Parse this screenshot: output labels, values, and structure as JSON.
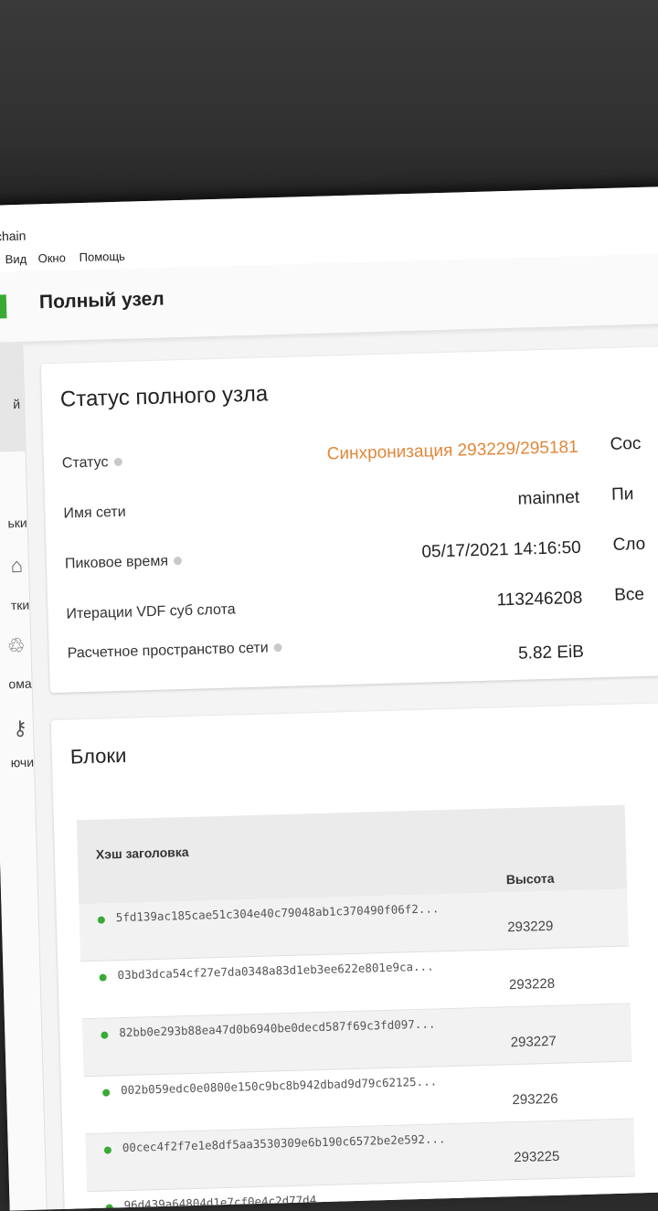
{
  "app": {
    "title": "chain"
  },
  "menu": {
    "items": [
      "а",
      "Вид",
      "Окно",
      "Помощь"
    ]
  },
  "header": {
    "title": "Полный узел"
  },
  "sidebar": {
    "items": [
      "й",
      "ьки",
      "тки",
      "ома",
      "ючи"
    ]
  },
  "status_card": {
    "title": "Статус полного узла",
    "rows": [
      {
        "label": "Статус",
        "value": "Синхронизация 293229/295181"
      },
      {
        "label": "Имя сети",
        "value": "mainnet"
      },
      {
        "label": "Пиковое время",
        "value": "05/17/2021 14:16:50"
      },
      {
        "label": "Итерации VDF суб слота",
        "value": "113246208"
      },
      {
        "label": "Расчетное пространство сети",
        "value": "5.82 EiB"
      }
    ],
    "right_column": [
      "Сос",
      "Пи",
      "Сло",
      "Все"
    ]
  },
  "blocks": {
    "title": "Блоки",
    "columns": {
      "hash": "Хэш заголовка",
      "height": "Высота"
    },
    "rows": [
      {
        "hash": "5fd139ac185cae51c304e40c79048ab1c370490f06f2...",
        "height": "293229"
      },
      {
        "hash": "03bd3dca54cf27e7da0348a83d1eb3ee622e801e9ca...",
        "height": "293228"
      },
      {
        "hash": "82bb0e293b88ea47d0b6940be0decd587f69c3fd097...",
        "height": "293227"
      },
      {
        "hash": "002b059edc0e0800e150c9bc8b942dbad9d79c62125...",
        "height": "293226"
      },
      {
        "hash": "00cec4f2f7e1e8df5aa3530309e6b190c6572be2e592...",
        "height": "293225"
      },
      {
        "hash": "96d439a64804d1e7cf0e4c2d77d4...",
        "height": ""
      }
    ]
  },
  "colors": {
    "accent": "#3aaa35",
    "sync": "#e0883a"
  }
}
